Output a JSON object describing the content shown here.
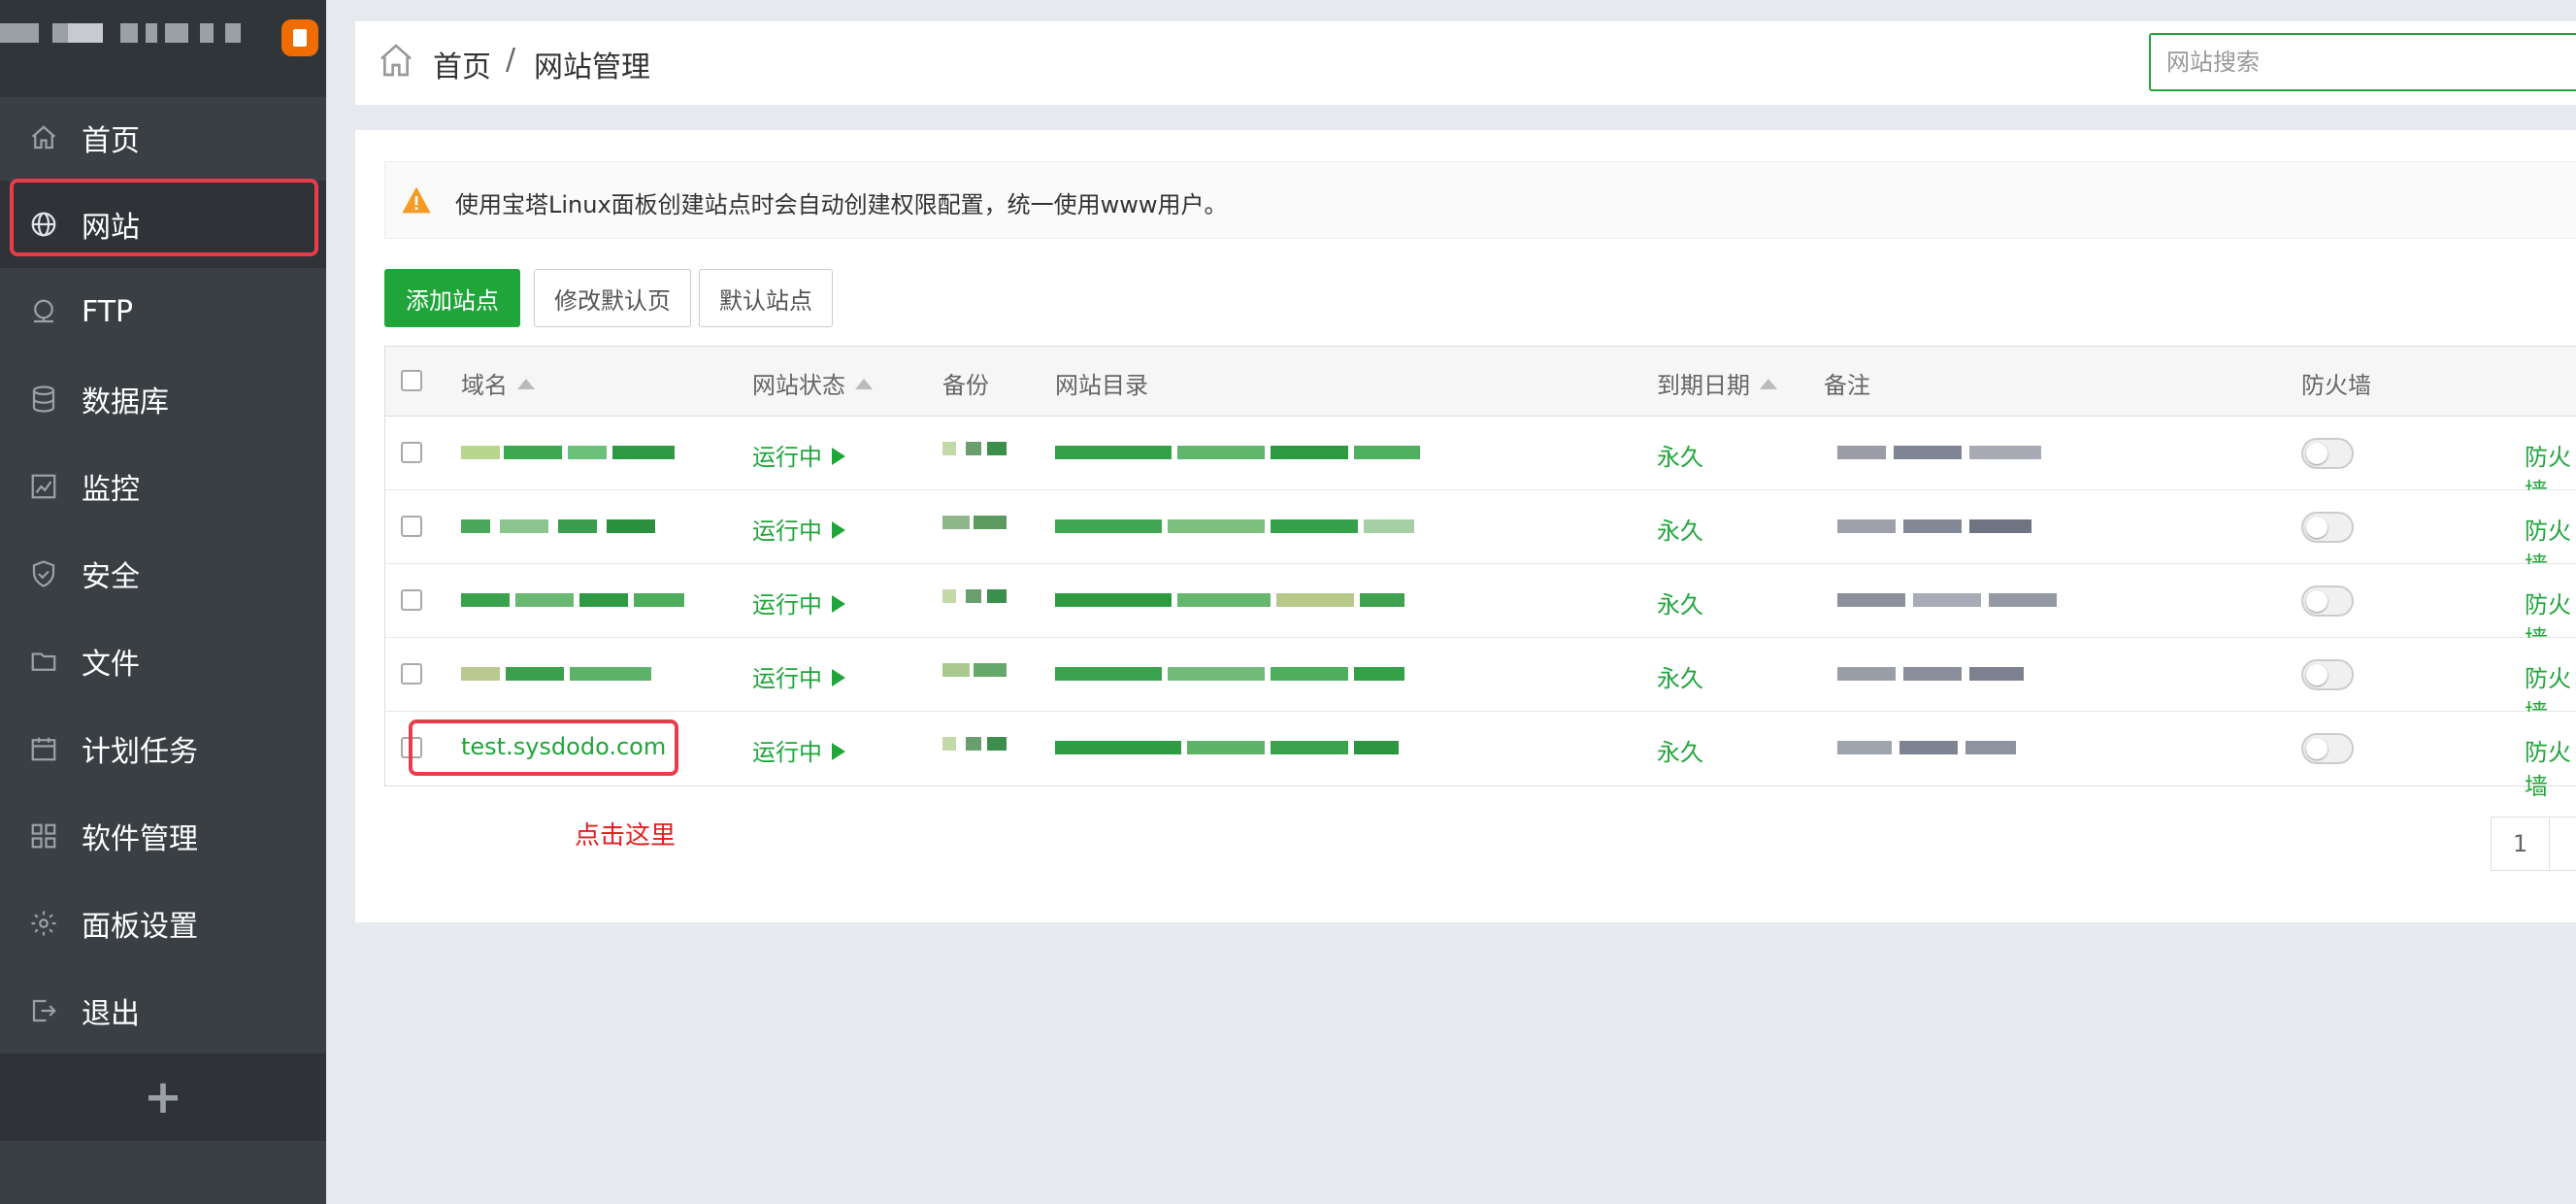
{
  "sidebar": {
    "items": [
      {
        "label": "首页",
        "icon": "home-icon",
        "key": "home"
      },
      {
        "label": "网站",
        "icon": "globe-icon",
        "key": "website",
        "active": true
      },
      {
        "label": "FTP",
        "icon": "ftp-icon",
        "key": "ftp"
      },
      {
        "label": "数据库",
        "icon": "database-icon",
        "key": "database"
      },
      {
        "label": "监控",
        "icon": "monitor-icon",
        "key": "monitor"
      },
      {
        "label": "安全",
        "icon": "shield-icon",
        "key": "security"
      },
      {
        "label": "文件",
        "icon": "folder-icon",
        "key": "files"
      },
      {
        "label": "计划任务",
        "icon": "calendar-icon",
        "key": "cron"
      },
      {
        "label": "软件管理",
        "icon": "apps-grid-icon",
        "key": "software"
      },
      {
        "label": "面板设置",
        "icon": "gear-icon",
        "key": "settings"
      },
      {
        "label": "退出",
        "icon": "logout-icon",
        "key": "logout"
      }
    ],
    "add_label": "+"
  },
  "breadcrumb": {
    "home": "首页",
    "separator": "/",
    "current": "网站管理"
  },
  "search": {
    "placeholder": "网站搜索"
  },
  "notice": {
    "text": "使用宝塔Linux面板创建站点时会自动创建权限配置，统一使用www用户。"
  },
  "toolbar": {
    "add_site": "添加站点",
    "edit_default_page": "修改默认页",
    "default_site": "默认站点"
  },
  "table": {
    "columns": {
      "domain": "域名",
      "status": "网站状态",
      "backup": "备份",
      "root": "网站目录",
      "expire": "到期日期",
      "remark": "备注",
      "firewall": "防火墙"
    },
    "rows": [
      {
        "status": "运行中",
        "expire": "永久",
        "firewall_link": "防火墙"
      },
      {
        "status": "运行中",
        "expire": "永久",
        "firewall_link": "防火墙"
      },
      {
        "status": "运行中",
        "expire": "永久",
        "firewall_link": "防火墙"
      },
      {
        "status": "运行中",
        "expire": "永久",
        "firewall_link": "防火墙"
      },
      {
        "domain": "test.sysdodo.com",
        "status": "运行中",
        "expire": "永久",
        "firewall_link": "防火墙"
      }
    ]
  },
  "annotation": {
    "text": "点击这里"
  },
  "pagination": {
    "current": "1"
  },
  "colors": {
    "accent": "#20a53a",
    "sidebar": "#3a3f44",
    "highlight": "#e73d4a",
    "annotation": "#e02020"
  }
}
